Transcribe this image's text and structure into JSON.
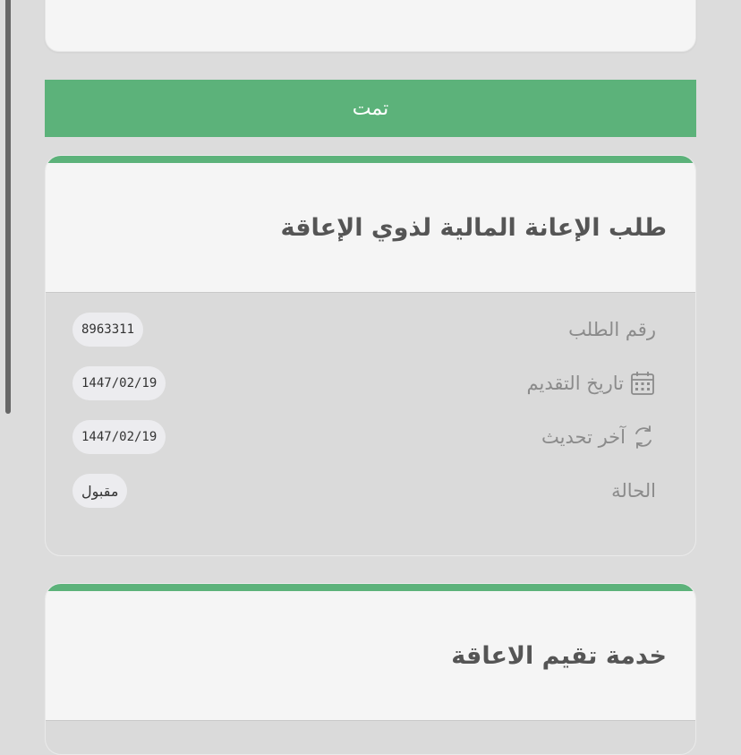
{
  "status_banner": {
    "label": "تمت"
  },
  "cards": [
    {
      "title": "طلب الإعانة المالية لذوي الإعاقة",
      "rows": [
        {
          "label": "رقم الطلب",
          "icon": "",
          "value": "8963311"
        },
        {
          "label": "تاريخ التقديم",
          "icon": "calendar-icon",
          "value": "1447/02/19"
        },
        {
          "label": "آخر تحديث",
          "icon": "refresh-icon",
          "value": "1447/02/19"
        },
        {
          "label": "الحالة",
          "icon": "",
          "value": "مقبول"
        }
      ]
    },
    {
      "title": "خدمة تقيم الاعاقة"
    }
  ],
  "colors": {
    "accent": "#5cb27a",
    "header_bg": "#f5f5f5",
    "body_bg": "#dadada",
    "page_bg": "#dcdcdc"
  }
}
